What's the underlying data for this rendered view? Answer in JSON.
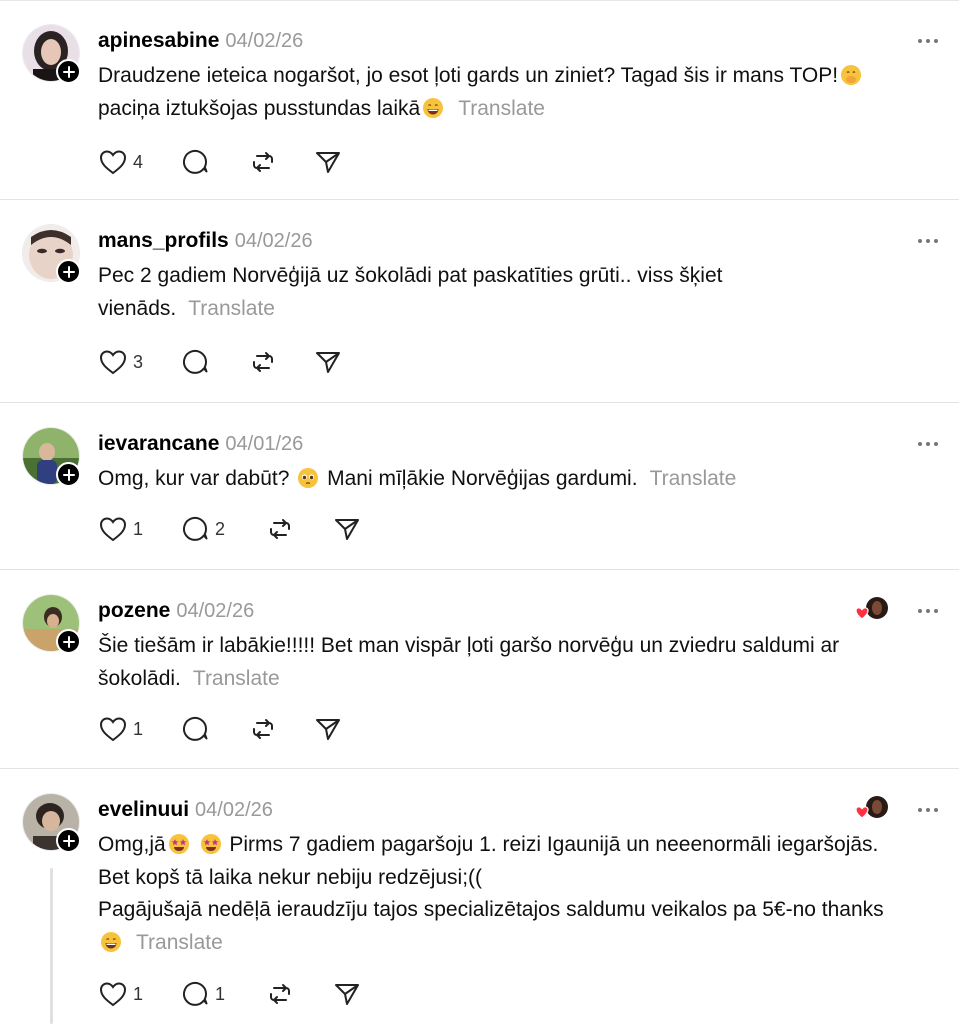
{
  "colors": {
    "text": "#101010",
    "muted": "#999999",
    "divider": "#e3e3e3",
    "liked_heart": "#ff3040"
  },
  "posts": [
    {
      "username": "apinesabine",
      "date": "04/02/26",
      "text_parts": [
        "Draudzene ieteica nogaršot, jo esot ļoti gards un ziniet? Tagad šis ir mans TOP!",
        "paciņa iztukšojas pusstundas laikā"
      ],
      "emojis": [
        "face-with-hand-over-mouth",
        "grinning-face"
      ],
      "translate": "Translate",
      "likes": "4",
      "replies": "",
      "liked_by_author": false
    },
    {
      "username": "mans_profils",
      "date": "04/02/26",
      "text_parts": [
        "Pec 2 gadiem Norvēģijā uz šokolādi pat paskatīties grūti.. viss šķiet vienāds."
      ],
      "emojis": [],
      "translate": "Translate",
      "likes": "3",
      "replies": "",
      "liked_by_author": false
    },
    {
      "username": "ievarancane",
      "date": "04/01/26",
      "text_parts": [
        "Omg, kur var dabūt?",
        "Mani mīļākie Norvēģijas gardumi."
      ],
      "emojis": [
        "pleading-face"
      ],
      "translate": "Translate",
      "likes": "1",
      "replies": "2",
      "liked_by_author": false
    },
    {
      "username": "pozene",
      "date": "04/02/26",
      "text_parts": [
        "Šie tiešām ir labākie!!!!! Bet man vispār ļoti garšo norvēģu un zviedru saldumi ar šokolādi."
      ],
      "emojis": [],
      "translate": "Translate",
      "likes": "1",
      "replies": "",
      "liked_by_author": true
    },
    {
      "username": "evelinuui",
      "date": "04/02/26",
      "text_parts": [
        "Omg,jā",
        "Pirms 7 gadiem pagaršoju 1. reizi Igaunijā un neeenormāli iegaršojās. Bet kopš tā laika nekur nebiju redzējusi;((",
        "Pagājušajā nedēļā ieraudzīju tajos specializētajos saldumu veikalos pa 5€-no thanks"
      ],
      "emojis": [
        "star-struck",
        "star-struck",
        "grinning-face"
      ],
      "translate": "Translate",
      "likes": "1",
      "replies": "1",
      "liked_by_author": true
    }
  ]
}
